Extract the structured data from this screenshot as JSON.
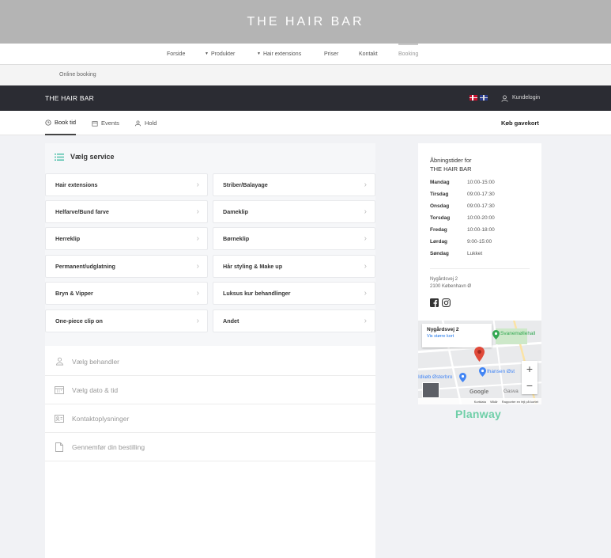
{
  "header": {
    "title": "THE HAIR BAR"
  },
  "nav": {
    "items": [
      {
        "label": "Forside",
        "caret": false,
        "active": false
      },
      {
        "label": "Produkter",
        "caret": true,
        "active": false
      },
      {
        "label": "Hair extensions",
        "caret": true,
        "active": false
      },
      {
        "label": "Priser",
        "caret": false,
        "active": false
      },
      {
        "label": "Kontakt",
        "caret": false,
        "active": false
      },
      {
        "label": "Booking",
        "caret": false,
        "active": true
      }
    ]
  },
  "breadcrumb": {
    "label": "Online booking"
  },
  "bookingBar": {
    "brand": "THE HAIR BAR",
    "login_label": "Kundelogin"
  },
  "tabs": {
    "items": [
      {
        "label": "Book tid",
        "icon": "clock-icon",
        "active": true
      },
      {
        "label": "Events",
        "icon": "calendar-icon",
        "active": false
      },
      {
        "label": "Hold",
        "icon": "people-icon",
        "active": false
      }
    ],
    "gift_label": "Køb gavekort"
  },
  "services": {
    "heading": "Vælg service",
    "items": [
      "Hair extensions",
      "Striber/Balayage",
      "Helfarve/Bund farve",
      "Dameklip",
      "Herreklip",
      "Børneklip",
      "Permanent/udglatning",
      "Hår styling & Make up",
      "Bryn & Vipper",
      "Luksus kur behandlinger",
      "One-piece clip on",
      "Andet"
    ]
  },
  "steps": [
    {
      "label": "Vælg behandler",
      "icon": "person-icon"
    },
    {
      "label": "Vælg dato & tid",
      "icon": "calendar-icon"
    },
    {
      "label": "Kontaktoplysninger",
      "icon": "contact-card-icon"
    },
    {
      "label": "Gennemfør din bestilling",
      "icon": "document-icon"
    }
  ],
  "hours": {
    "title_line1": "Åbningstider for",
    "title_line2": "THE HAIR BAR",
    "days": [
      {
        "day": "Mandag",
        "time": "10:00-15:00"
      },
      {
        "day": "Tirsdag",
        "time": "09:00-17:30"
      },
      {
        "day": "Onsdag",
        "time": "09:00-17:30"
      },
      {
        "day": "Torsdag",
        "time": "10:00-20:00"
      },
      {
        "day": "Fredag",
        "time": "10:00-18:00"
      },
      {
        "day": "Lørdag",
        "time": "9:00-15:00"
      },
      {
        "day": "Søndag",
        "time": "Lukket"
      }
    ],
    "address_line1": "Nygårdsvej 2",
    "address_line2": "2100 København Ø"
  },
  "map": {
    "place": "Nygårdsvej 2",
    "larger_map_link": "Vis større kort",
    "poi_1": "Svanemøllehall",
    "poi_2": "Ihansen Øst",
    "poi_3": "Idkøb Østerbro",
    "poi_4": "Gasva",
    "google": "Google",
    "footer_1": "Kortdata",
    "footer_2": "Vilkår",
    "footer_3": "Rapporter en fejl på kortet",
    "zoom_in": "+",
    "zoom_out": "−",
    "pin_color": "#e04a3a",
    "poi_color": "#34a853"
  },
  "footer": {
    "powered_by": "Planway"
  }
}
